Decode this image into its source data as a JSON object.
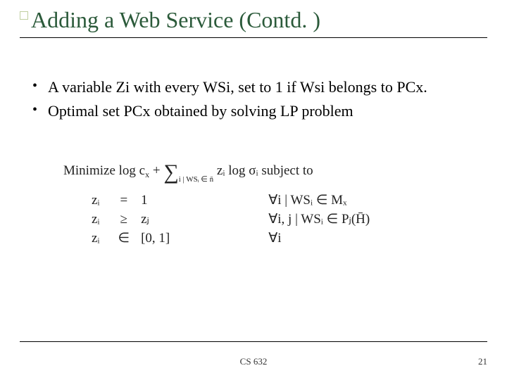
{
  "title": "Adding a Web Service (Contd. )",
  "bullets": [
    "A variable Zi with every WSi, set to 1 if Wsi belongs to PCx.",
    "Optimal set PCx obtained by solving LP problem"
  ],
  "math": {
    "objective_prefix": "Minimize log c",
    "objective_sub1": "x",
    "objective_plus": " + ",
    "objective_sumcond": "i | WSᵢ ∈ n̄",
    "objective_tail": " zᵢ log σᵢ subject to",
    "rows": [
      {
        "lhs": "zᵢ",
        "rel": "=",
        "rhs": "1",
        "cond": "∀i | WSᵢ ∈ Mₓ"
      },
      {
        "lhs": "zᵢ",
        "rel": "≥",
        "rhs": "zⱼ",
        "cond": "∀i, j | WSᵢ ∈ Pⱼ(H̄)"
      },
      {
        "lhs": "zᵢ",
        "rel": "∈",
        "rhs": "[0, 1]",
        "cond": "∀i"
      }
    ]
  },
  "footer": {
    "center": "CS 632",
    "page": "21"
  }
}
